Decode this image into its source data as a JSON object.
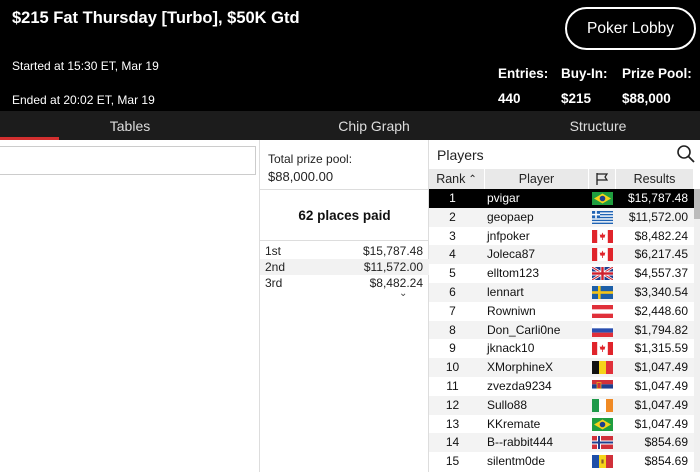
{
  "header": {
    "title": "$215 Fat Thursday [Turbo], $50K Gtd",
    "started": "Started at 15:30 ET, Mar 19",
    "ended": "Ended at 20:02 ET, Mar 19",
    "lobby_button": "Poker Lobby",
    "stats": [
      {
        "label": "Entries:",
        "value": "440"
      },
      {
        "label": "Buy-In:",
        "value": "$215"
      },
      {
        "label": "Prize Pool:",
        "value": "$88,000"
      }
    ]
  },
  "tabs": [
    {
      "label": "Tables"
    },
    {
      "label": "Chip Graph"
    },
    {
      "label": "Structure"
    }
  ],
  "colors": {
    "tab_accent": "#d32f2f"
  },
  "prize": {
    "total_label": "Total prize pool:",
    "total_value": "$88,000.00",
    "places_paid": "62 places paid",
    "payouts": [
      {
        "place": "1st",
        "amount": "$15,787.48"
      },
      {
        "place": "2nd",
        "amount": "$11,572.00"
      },
      {
        "place": "3rd",
        "amount": "$8,482.24"
      }
    ]
  },
  "players": {
    "title": "Players",
    "columns": {
      "rank": "Rank",
      "player": "Player",
      "results": "Results"
    },
    "rows": [
      {
        "rank": "1",
        "name": "pvigar",
        "flag": "brazil",
        "result": "$15,787.48"
      },
      {
        "rank": "2",
        "name": "geopaep",
        "flag": "greece",
        "result": "$11,572.00"
      },
      {
        "rank": "3",
        "name": "jnfpoker",
        "flag": "canada",
        "result": "$8,482.24"
      },
      {
        "rank": "4",
        "name": "Joleca87",
        "flag": "canada",
        "result": "$6,217.45"
      },
      {
        "rank": "5",
        "name": "elltom123",
        "flag": "uk",
        "result": "$4,557.37"
      },
      {
        "rank": "6",
        "name": "lennart",
        "flag": "sweden",
        "result": "$3,340.54"
      },
      {
        "rank": "7",
        "name": "Rowniwn",
        "flag": "austria",
        "result": "$2,448.60"
      },
      {
        "rank": "8",
        "name": "Don_Carli0ne",
        "flag": "russia",
        "result": "$1,794.82"
      },
      {
        "rank": "9",
        "name": "jknack10",
        "flag": "canada",
        "result": "$1,315.59"
      },
      {
        "rank": "10",
        "name": "XMorphineX",
        "flag": "belgium",
        "result": "$1,047.49"
      },
      {
        "rank": "11",
        "name": "zvezda9234",
        "flag": "serbia",
        "result": "$1,047.49"
      },
      {
        "rank": "12",
        "name": "Sullo88",
        "flag": "ireland",
        "result": "$1,047.49"
      },
      {
        "rank": "13",
        "name": "KKremate",
        "flag": "brazil",
        "result": "$1,047.49"
      },
      {
        "rank": "14",
        "name": "B--rabbit444",
        "flag": "norway",
        "result": "$854.69"
      },
      {
        "rank": "15",
        "name": "silentm0de",
        "flag": "moldova",
        "result": "$854.69"
      }
    ]
  }
}
